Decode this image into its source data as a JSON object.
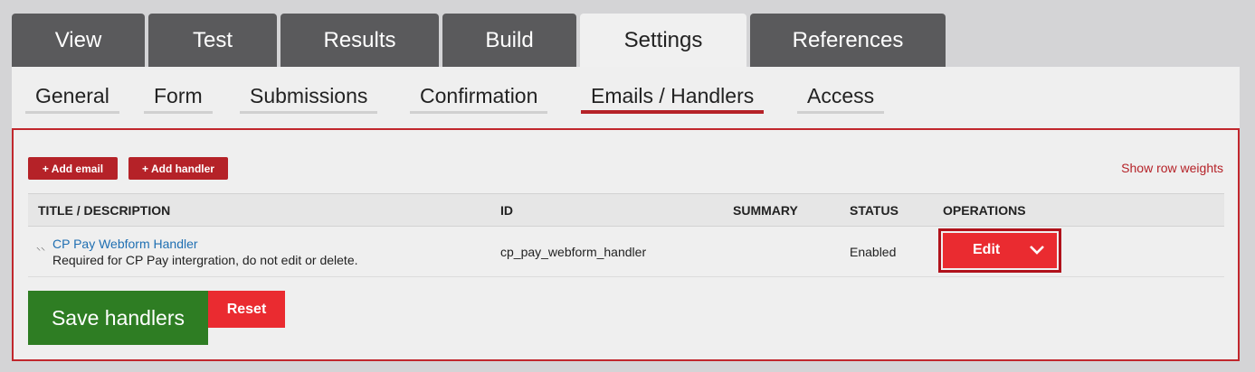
{
  "primary_tabs": [
    {
      "label": "View"
    },
    {
      "label": "Test"
    },
    {
      "label": "Results"
    },
    {
      "label": "Build"
    },
    {
      "label": "Settings",
      "active": true
    },
    {
      "label": "References"
    }
  ],
  "secondary_tabs": [
    {
      "label": "General"
    },
    {
      "label": "Form"
    },
    {
      "label": "Submissions"
    },
    {
      "label": "Confirmation"
    },
    {
      "label": "Emails / Handlers",
      "active": true
    },
    {
      "label": "Access"
    }
  ],
  "actions": {
    "add_email": "+ Add email",
    "add_handler": "+ Add handler",
    "show_row_weights": "Show row weights"
  },
  "table": {
    "headers": [
      "TITLE / DESCRIPTION",
      "ID",
      "SUMMARY",
      "STATUS",
      "OPERATIONS"
    ],
    "rows": [
      {
        "title": "CP Pay Webform Handler",
        "description": "Required for CP Pay intergration, do not edit or delete.",
        "id": "cp_pay_webform_handler",
        "summary": "",
        "status": "Enabled",
        "operation": "Edit"
      }
    ]
  },
  "footer": {
    "save_label": "Save handlers",
    "reset_label": "Reset"
  },
  "colors": {
    "accent": "#b52228",
    "edit_button": "#ea2b30",
    "save_button": "#2e7d23",
    "link": "#1f6fb2"
  },
  "icons": {
    "drag": "drag-handle-icon",
    "dropdown": "chevron-down-icon"
  }
}
